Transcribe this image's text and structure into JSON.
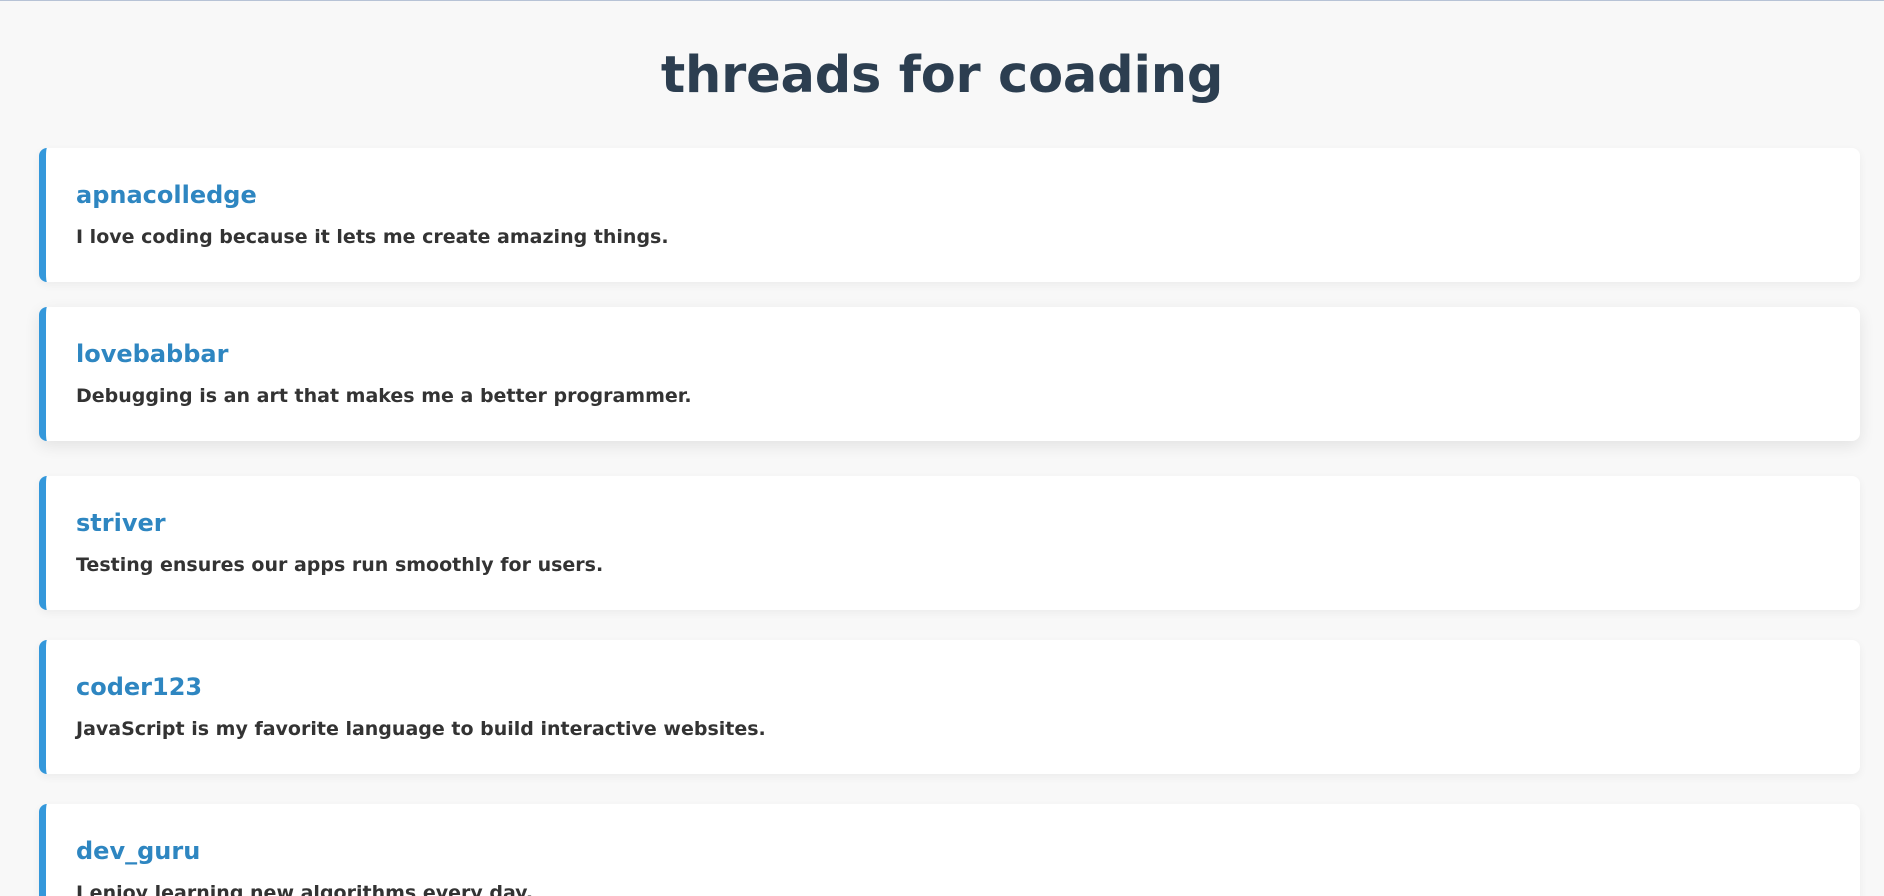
{
  "page": {
    "title": "threads for coading"
  },
  "colors": {
    "background": "#f8f8f8",
    "title": "#2c3e50",
    "username": "#2e86c1",
    "text": "#333333",
    "card_accent": "#3498db",
    "card_background": "#ffffff"
  },
  "threads": [
    {
      "username": "apnacolledge",
      "text": "I love coding because it lets me create amazing things."
    },
    {
      "username": "lovebabbar",
      "text": "Debugging is an art that makes me a better programmer."
    },
    {
      "username": "striver",
      "text": "Testing ensures our apps run smoothly for users."
    },
    {
      "username": "coder123",
      "text": "JavaScript is my favorite language to build interactive websites."
    },
    {
      "username": "dev_guru",
      "text": "I enjoy learning new algorithms every day."
    }
  ]
}
